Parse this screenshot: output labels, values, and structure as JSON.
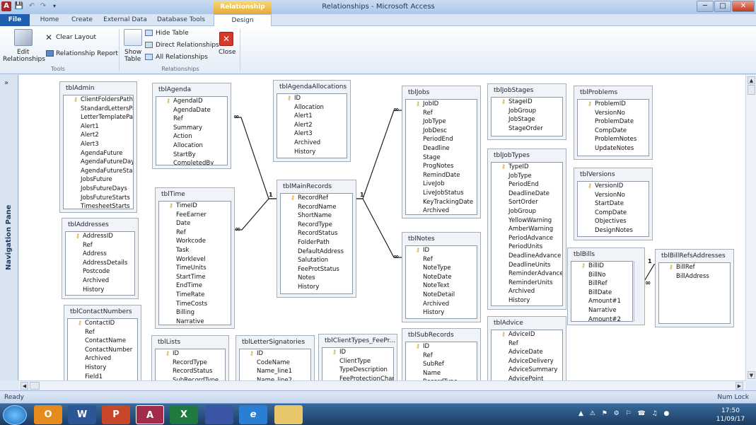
{
  "window": {
    "title": "Relationships - Microsoft Access",
    "context_tab": "Relationship Tools",
    "app_icon": "A",
    "save_icon": "💾",
    "undo_icon": "↶",
    "redo_icon": "↷",
    "qat_menu_icon": "▾",
    "minimize": "─",
    "maximize": "□",
    "close": "✕"
  },
  "tabs": {
    "file": "File",
    "home": "Home",
    "create": "Create",
    "external": "External Data",
    "dbtools": "Database Tools",
    "design": "Design",
    "right_icons": "▵ ❓ — ❐ ✕"
  },
  "ribbon": {
    "edit_rel_line1": "Edit",
    "edit_rel_line2": "Relationships",
    "clear_layout": "Clear Layout",
    "rel_report": "Relationship Report",
    "show_table_line1": "Show",
    "show_table_line2": "Table",
    "hide_table": "Hide Table",
    "direct_rel": "Direct Relationships",
    "all_rel": "All Relationships",
    "close": "Close",
    "group_tools": "Tools",
    "group_rel": "Relationships"
  },
  "nav": {
    "label": "Navigation Pane",
    "collapse_icon": "»"
  },
  "status": {
    "ready": "Ready",
    "numlock": "Num Lock"
  },
  "clock": {
    "time": "17:50",
    "date": "11/09/17"
  },
  "tables": {
    "tblAdmin": {
      "title": "tblAdmin",
      "fields": [
        "ClientFoldersPath",
        "StandardLettersPath",
        "LetterTemplatePath",
        "Alert1",
        "Alert2",
        "Alert3",
        "AgendaFuture",
        "AgendaFutureDays",
        "AgendaFutureStart",
        "JobsFuture",
        "JobsFutureDays",
        "JobsFutureStarts",
        "TimesheetStarts"
      ]
    },
    "tblAgenda": {
      "title": "tblAgenda",
      "fields": [
        "AgendaID",
        "AgendaDate",
        "Ref",
        "Summary",
        "Action",
        "Allocation",
        "StartBy",
        "CompletedBy"
      ]
    },
    "tblAgendaAllocations": {
      "title": "tblAgendaAllocations",
      "fields": [
        "ID",
        "Allocation",
        "Alert1",
        "Alert2",
        "Alert3",
        "Archived",
        "History"
      ]
    },
    "tblJobs": {
      "title": "tblJobs",
      "fields": [
        "JobID",
        "Ref",
        "JobType",
        "JobDesc",
        "PeriodEnd",
        "Deadline",
        "Stage",
        "ProgNotes",
        "RemindDate",
        "LiveJob",
        "LiveJobStatus",
        "KeyTrackingDate",
        "Archived"
      ]
    },
    "tblJobStages": {
      "title": "tblJobStages",
      "fields": [
        "StageID",
        "JobGroup",
        "JobStage",
        "StageOrder"
      ]
    },
    "tblProblems": {
      "title": "tblProblems",
      "fields": [
        "ProblemID",
        "VersionNo",
        "ProblemDate",
        "CompDate",
        "ProblemNotes",
        "UpdateNotes"
      ]
    },
    "tblAddresses": {
      "title": "tblAddresses",
      "fields": [
        "AddressID",
        "Ref",
        "Address",
        "AddressDetails",
        "Postcode",
        "Archived",
        "History"
      ]
    },
    "tblTime": {
      "title": "tblTime",
      "fields": [
        "TimeID",
        "FeeEarner",
        "Date",
        "Ref",
        "Workcode",
        "Task",
        "Worklevel",
        "TimeUnits",
        "StartTime",
        "EndTime",
        "TimeRate",
        "TimeCosts",
        "Billing",
        "Narrative"
      ]
    },
    "tblMainRecords": {
      "title": "tblMainRecords",
      "fields": [
        "RecordRef",
        "RecordName",
        "ShortName",
        "RecordType",
        "RecordStatus",
        "FolderPath",
        "DefaultAddress",
        "Salutation",
        "FeeProtStatus",
        "Notes",
        "History"
      ]
    },
    "tblJobTypes": {
      "title": "tblJobTypes",
      "fields": [
        "TypeID",
        "JobType",
        "PeriodEnd",
        "DeadlineDate",
        "SortOrder",
        "JobGroup",
        "YellowWarning",
        "AmberWarning",
        "PeriodAdvance",
        "PeriodUnits",
        "DeadlineAdvance",
        "DeadlineUnits",
        "ReminderAdvance",
        "ReminderUnits",
        "Archived",
        "History"
      ]
    },
    "tblVersions": {
      "title": "tblVersions",
      "fields": [
        "VersionID",
        "VersionNo",
        "StartDate",
        "CompDate",
        "Objectives",
        "DesignNotes"
      ]
    },
    "tblNotes": {
      "title": "tblNotes",
      "fields": [
        "ID",
        "Ref",
        "NoteType",
        "NoteDate",
        "NoteText",
        "NoteDetail",
        "Archived",
        "History"
      ]
    },
    "tblBills": {
      "title": "tblBills",
      "fields": [
        "BillID",
        "BillNo",
        "BillRef",
        "BillDate",
        "Amount#1",
        "Narrative",
        "Amount#2"
      ]
    },
    "tblBillRefsAddresses": {
      "title": "tblBillRefsAddresses",
      "fields": [
        "BillRef",
        "BillAddress"
      ]
    },
    "tblContactNumbers": {
      "title": "tblContactNumbers",
      "fields": [
        "ContactID",
        "Ref",
        "ContactName",
        "ContactNumber",
        "Archived",
        "History",
        "Field1"
      ]
    },
    "tblLists": {
      "title": "tblLists",
      "fields": [
        "ID",
        "RecordType",
        "RecordStatus",
        "SubRecordType"
      ]
    },
    "tblLetterSignatories": {
      "title": "tblLetterSignatories",
      "fields": [
        "ID",
        "CodeName",
        "Name_line1",
        "Name_line2"
      ]
    },
    "tblClientTypes": {
      "title": "tblClientTypes_FeePr...",
      "fields": [
        "ID",
        "ClientType",
        "TypeDescription",
        "FeeProtectionChar"
      ]
    },
    "tblSubRecords": {
      "title": "tblSubRecords",
      "fields": [
        "ID",
        "Ref",
        "SubRef",
        "Name",
        "RecordType"
      ]
    },
    "tblAdvice": {
      "title": "tblAdvice",
      "fields": [
        "AdviceID",
        "Ref",
        "AdviceDate",
        "AdviceDelivery",
        "AdviceSummary",
        "AdvicePoint"
      ]
    }
  },
  "relationships": {
    "one": "1",
    "many": "∞"
  },
  "taskbar": {
    "outlook": "O",
    "word": "W",
    "powerpoint": "P",
    "access": "A",
    "excel": "X",
    "ie": "e",
    "tray": "▲ ⚠ ⚑ ⚙ ⚐ ☎ ♫ ●"
  }
}
